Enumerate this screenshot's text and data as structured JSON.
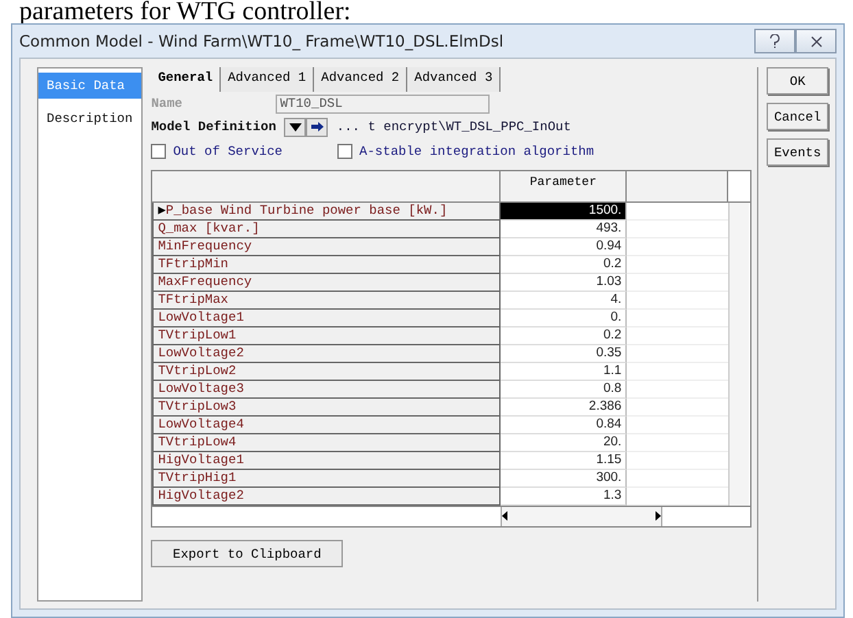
{
  "caption": "parameters for WTG controller:",
  "window": {
    "title": "Common Model - Wind Farm\\WT10_ Frame\\WT10_DSL.ElmDsl"
  },
  "sidebar": {
    "items": [
      {
        "label": "Basic Data",
        "selected": true
      },
      {
        "label": "Description",
        "selected": false
      }
    ]
  },
  "tabs": [
    {
      "label": "General",
      "selected": true
    },
    {
      "label": "Advanced 1",
      "selected": false
    },
    {
      "label": "Advanced 2",
      "selected": false
    },
    {
      "label": "Advanced 3",
      "selected": false
    }
  ],
  "name": {
    "label": "Name",
    "value": "WT10_DSL",
    "disabled": true
  },
  "model_definition": {
    "label": "Model Definition",
    "path": "... t encrypt\\WT_DSL_PPC_InOut"
  },
  "checkboxes": [
    {
      "label": "Out of Service",
      "checked": false
    },
    {
      "label": "A-stable integration algorithm",
      "checked": false
    }
  ],
  "table": {
    "columns": [
      "Parameter"
    ],
    "marker": "▶",
    "rows": [
      {
        "name": "P_base Wind Turbine power base [kW.]",
        "value": "1500.",
        "selected": true
      },
      {
        "name": "Q_max [kvar.]",
        "value": "493.",
        "selected": false
      },
      {
        "name": "MinFrequency",
        "value": "0.94",
        "selected": false
      },
      {
        "name": "TFtripMin",
        "value": "0.2",
        "selected": false
      },
      {
        "name": "MaxFrequency",
        "value": "1.03",
        "selected": false
      },
      {
        "name": "TFtripMax",
        "value": "4.",
        "selected": false
      },
      {
        "name": "LowVoltage1",
        "value": "0.",
        "selected": false
      },
      {
        "name": "TVtripLow1",
        "value": "0.2",
        "selected": false
      },
      {
        "name": "LowVoltage2",
        "value": "0.35",
        "selected": false
      },
      {
        "name": "TVtripLow2",
        "value": "1.1",
        "selected": false
      },
      {
        "name": "LowVoltage3",
        "value": "0.8",
        "selected": false
      },
      {
        "name": "TVtripLow3",
        "value": "2.386",
        "selected": false
      },
      {
        "name": "LowVoltage4",
        "value": "0.84",
        "selected": false
      },
      {
        "name": "TVtripLow4",
        "value": "20.",
        "selected": false
      },
      {
        "name": "HigVoltage1",
        "value": "1.15",
        "selected": false
      },
      {
        "name": "TVtripHig1",
        "value": "300.",
        "selected": false
      },
      {
        "name": "HigVoltage2",
        "value": "1.3",
        "selected": false
      }
    ]
  },
  "export_button": "Export to Clipboard",
  "buttons": [
    "OK",
    "Cancel",
    "Events"
  ]
}
